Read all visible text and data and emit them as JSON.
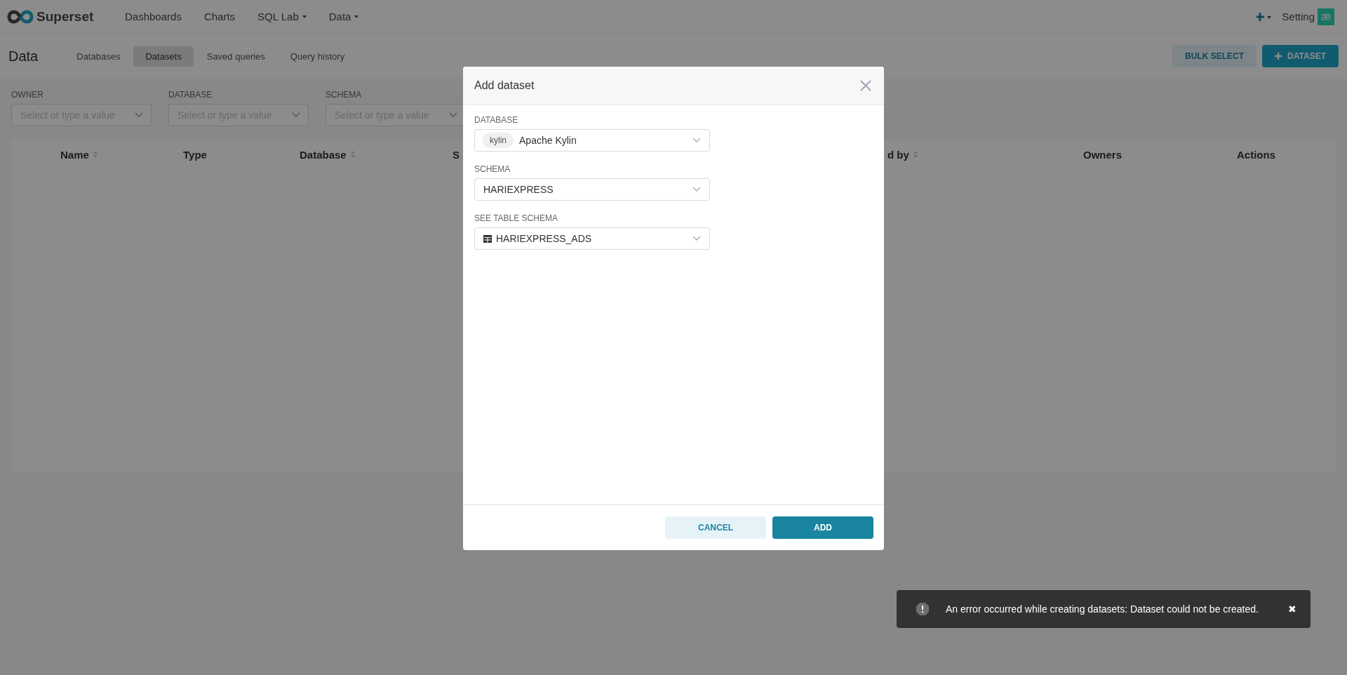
{
  "nav": {
    "brand": "Superset",
    "items": [
      {
        "label": "Dashboards",
        "dropdown": false
      },
      {
        "label": "Charts",
        "dropdown": false
      },
      {
        "label": "SQL Lab",
        "dropdown": true
      },
      {
        "label": "Data",
        "dropdown": true
      }
    ],
    "settings": "Setting",
    "avatar": "æ"
  },
  "subheader": {
    "title": "Data",
    "tabs": [
      {
        "label": "Databases",
        "selected": false
      },
      {
        "label": "Datasets",
        "selected": true
      },
      {
        "label": "Saved queries",
        "selected": false
      },
      {
        "label": "Query history",
        "selected": false
      }
    ],
    "buttons": [
      {
        "label": "BULK SELECT",
        "kind": "secondary"
      },
      {
        "label": "DATASET",
        "kind": "primary"
      }
    ]
  },
  "filters": [
    {
      "label": "OWNER",
      "placeholder": "Select or type a value"
    },
    {
      "label": "DATABASE",
      "placeholder": "Select or type a value"
    },
    {
      "label": "SCHEMA",
      "placeholder": "Select or type a value"
    }
  ],
  "table": {
    "columns": [
      {
        "label": "Name",
        "sortable": true
      },
      {
        "label": "Type",
        "sortable": false
      },
      {
        "label": "Database",
        "sortable": true
      },
      {
        "label": "S",
        "sortable": false
      },
      {
        "label": "d by",
        "sortable": true
      },
      {
        "label": "Owners",
        "sortable": false
      },
      {
        "label": "Actions",
        "sortable": false
      }
    ]
  },
  "modal": {
    "title": "Add dataset",
    "fields": [
      {
        "label": "DATABASE",
        "kind": "database",
        "tag": "kylin",
        "value": "Apache Kylin"
      },
      {
        "label": "SCHEMA",
        "kind": "plain",
        "value": "HARIEXPRESS"
      },
      {
        "label": "SEE TABLE SCHEMA",
        "kind": "table",
        "value": "HARIEXPRESS_ADS"
      }
    ],
    "buttons": [
      {
        "label": "CANCEL",
        "kind": "secondary"
      },
      {
        "label": "ADD",
        "kind": "primary"
      }
    ]
  },
  "toast": {
    "message": "An error occurred while creating datasets: Dataset could not be created.",
    "close": "✖"
  }
}
